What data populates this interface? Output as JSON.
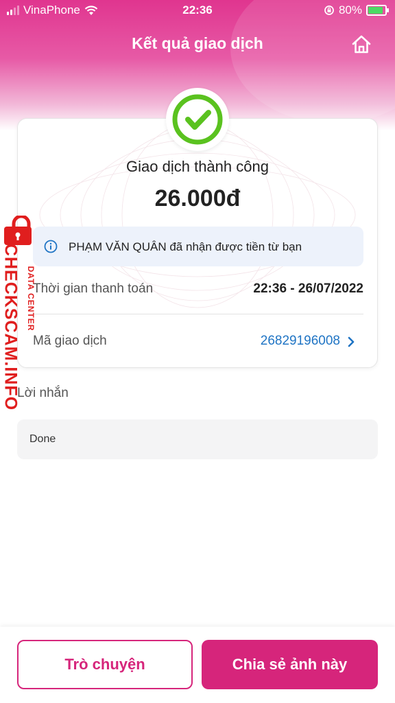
{
  "status_bar": {
    "carrier": "VinaPhone",
    "time": "22:36",
    "battery": "80%"
  },
  "header": {
    "title": "Kết quả giao dịch",
    "home_icon": "home-icon"
  },
  "result": {
    "status": "Giao dịch thành công",
    "amount": "26.000đ",
    "icon": "check-circle-icon",
    "accent_color": "#5ac21f"
  },
  "info": {
    "icon": "info-icon",
    "text": "PHẠM VĂN QUÂN đã nhận được tiền từ bạn"
  },
  "details": {
    "time_label": "Thời gian thanh toán",
    "time_value": "22:36 - 26/07/2022",
    "txn_label": "Mã giao dịch",
    "txn_value": "26829196008"
  },
  "message": {
    "label": "Lời nhắn",
    "text": "Done"
  },
  "actions": {
    "chat_label": "Trò chuyện",
    "share_label": "Chia sẻ ảnh này",
    "brand_color": "#d6257b"
  },
  "watermark": {
    "main": "CHECKSCAM.INFO",
    "sub": "DATA CENTER"
  }
}
